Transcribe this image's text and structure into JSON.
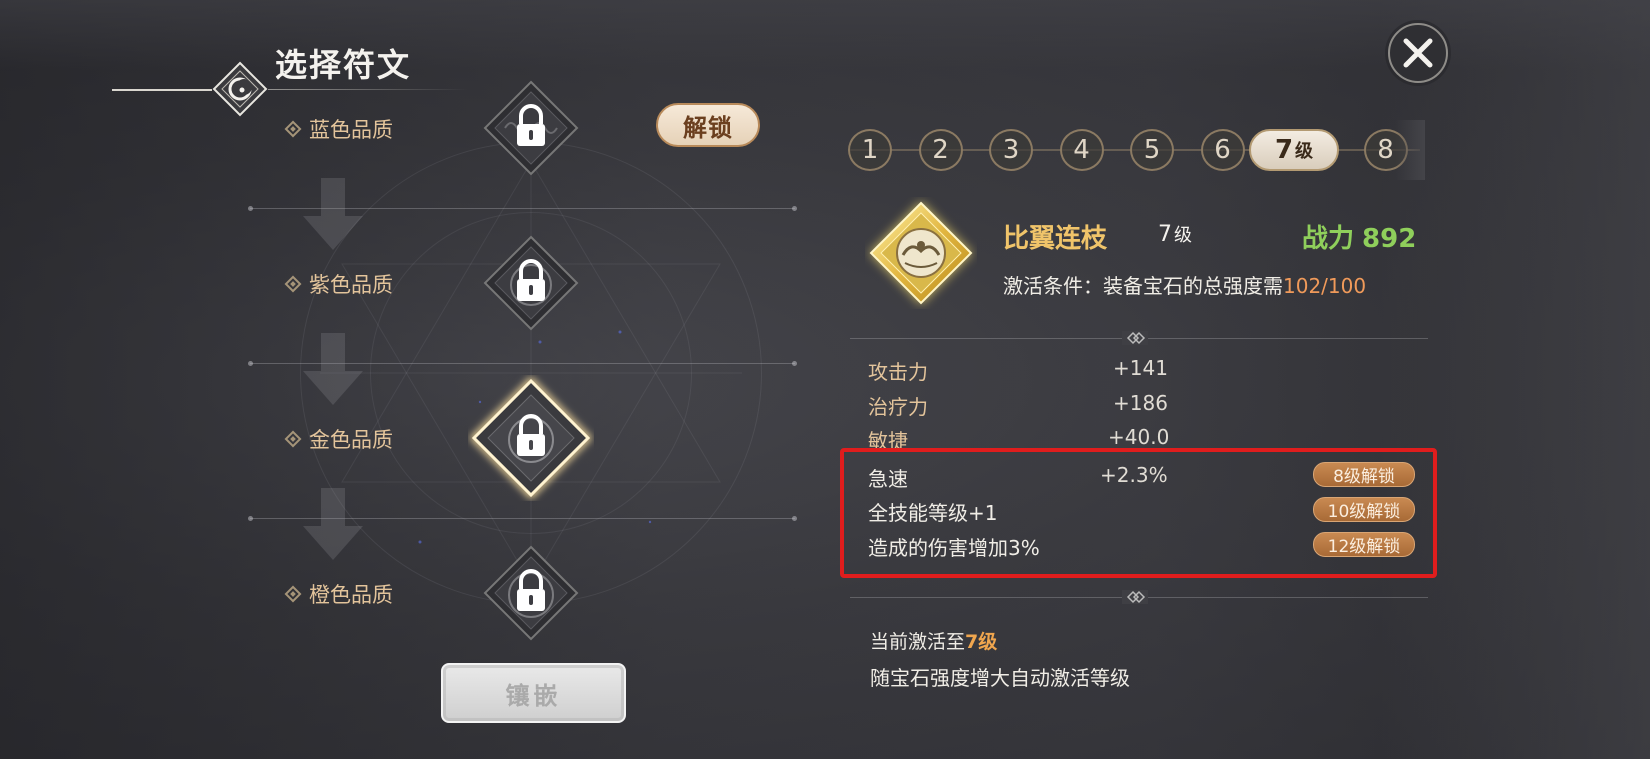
{
  "header": {
    "title": "选择符文"
  },
  "qualities": [
    {
      "label": "蓝色品质"
    },
    {
      "label": "紫色品质"
    },
    {
      "label": "金色品质"
    },
    {
      "label": "橙色品质"
    }
  ],
  "buttons": {
    "unlock": "解锁",
    "inlay": "镶嵌"
  },
  "level_tabs": {
    "items": [
      "1",
      "2",
      "3",
      "4",
      "5",
      "6",
      "7",
      "8"
    ],
    "active_index": 6,
    "active_suffix": "级"
  },
  "rune": {
    "name": "比翼连枝",
    "level_num": "7",
    "level_suffix": "级",
    "power_label": "战力",
    "power_value": "892",
    "activate_prefix": "激活条件：装备宝石的总强度需",
    "activate_value": "102/100"
  },
  "stats": [
    {
      "name": "攻击力",
      "value": "+141"
    },
    {
      "name": "治疗力",
      "value": "+186"
    },
    {
      "name": "敏捷",
      "value": "+40.0"
    }
  ],
  "locked_stats": [
    {
      "name": "急速",
      "value": "+2.3%",
      "badge": "8级解锁"
    },
    {
      "name": "全技能等级+1",
      "value": "",
      "badge": "10级解锁"
    },
    {
      "name": "造成的伤害增加3%",
      "value": "",
      "badge": "12级解锁"
    }
  ],
  "footer": {
    "current_prefix": "当前激活至",
    "current_level": "7级",
    "auto_note": "随宝石强度增大自动激活等级"
  },
  "colors": {
    "accent_gold": "#f0c46a",
    "power_green": "#8fcf5b",
    "highlight_red": "#e01d1d",
    "badge_orange": "#b8784a"
  },
  "icons": {
    "close": "close-x-icon",
    "lock": "lock-icon",
    "emblem": "moon-emblem-icon"
  }
}
